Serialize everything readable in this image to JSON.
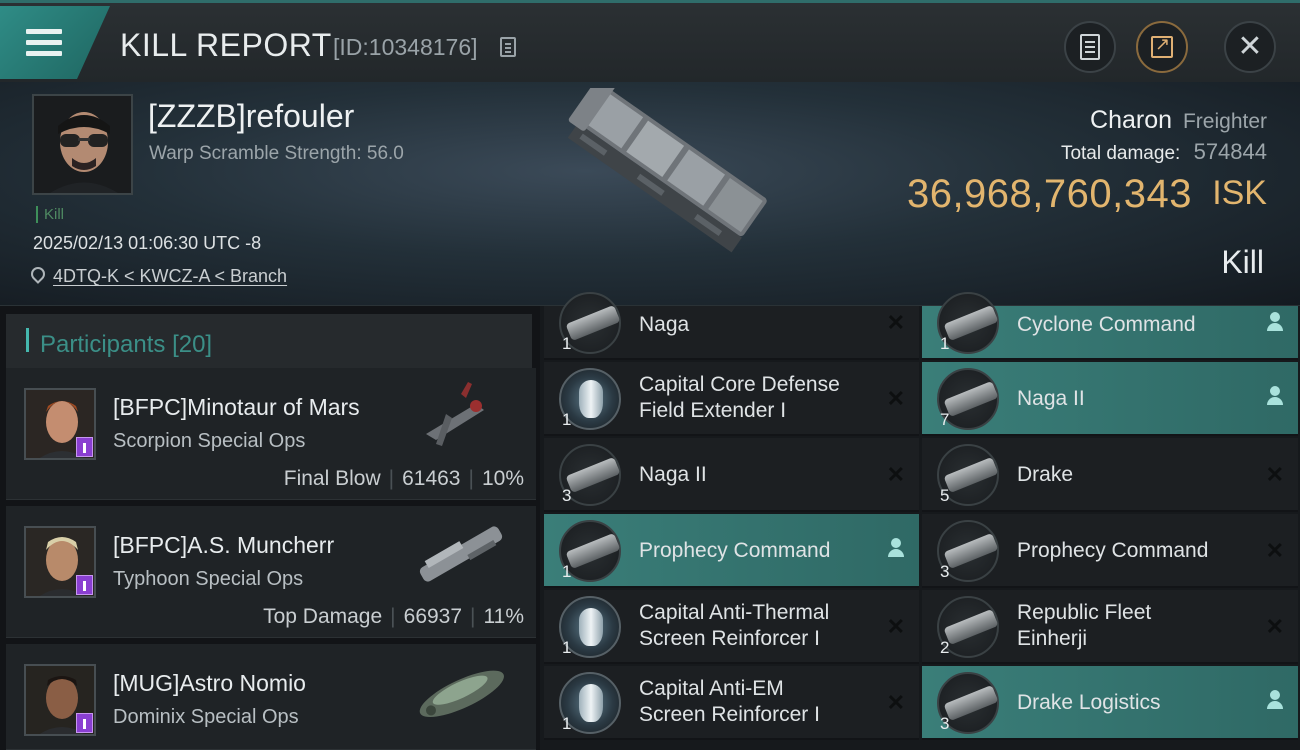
{
  "header": {
    "title": "KILL REPORT",
    "report_id": "[ID:10348176]"
  },
  "victim": {
    "name": "[ZZZB]refouler",
    "scramble": "Warp Scramble Strength: 56.0",
    "kill_tag": "Kill",
    "time": "2025/02/13 01:06:30 UTC -8",
    "location": "4DTQ-K < KWCZ-A < Branch",
    "ship_name": "Charon",
    "ship_class": "Freighter",
    "total_damage_label": "Total damage:",
    "total_damage": "574844",
    "isk_value": "36,968,760,343",
    "isk_unit": "ISK",
    "result": "Kill"
  },
  "participants": {
    "label": "Participants",
    "count": "[20]",
    "rows": [
      {
        "name": "[BFPC]Minotaur of Mars",
        "ship": "Scorpion Special Ops",
        "stat_label": "Final Blow",
        "damage": "61463",
        "percent": "10%"
      },
      {
        "name": "[BFPC]A.S. Muncherr",
        "ship": "Typhoon Special Ops",
        "stat_label": "Top Damage",
        "damage": "66937",
        "percent": "11%"
      },
      {
        "name": "[MUG]Astro Nomio",
        "ship": "Dominix Special Ops"
      }
    ]
  },
  "grid": {
    "left": [
      {
        "qty": "1",
        "label1": "Naga",
        "label2": "",
        "type": "ship",
        "icon": "ship-icon",
        "action": "close-icon"
      },
      {
        "qty": "1",
        "label1": "Capital Core Defense",
        "label2": "Field Extender I",
        "type": "module",
        "icon": "module-icon",
        "action": "close-icon"
      },
      {
        "qty": "3",
        "label1": "Naga II",
        "label2": "",
        "type": "ship",
        "icon": "ship-icon",
        "action": "close-icon"
      },
      {
        "qty": "1",
        "label1": "Prophecy Command",
        "label2": "",
        "type": "ship",
        "icon": "ship-icon",
        "action": "person-icon",
        "highlight": true
      },
      {
        "qty": "1",
        "label1": "Capital Anti-Thermal",
        "label2": "Screen Reinforcer I",
        "type": "module",
        "icon": "module-icon",
        "action": "close-icon"
      },
      {
        "qty": "1",
        "label1": "Capital Anti-EM",
        "label2": "Screen Reinforcer I",
        "type": "module",
        "icon": "module-icon",
        "action": "close-icon"
      }
    ],
    "right": [
      {
        "qty": "1",
        "label1": "Cyclone Command",
        "label2": "",
        "type": "ship",
        "icon": "ship-icon",
        "action": "person-icon",
        "highlight": true
      },
      {
        "qty": "7",
        "label1": "Naga II",
        "label2": "",
        "type": "ship",
        "icon": "ship-icon",
        "action": "person-icon",
        "highlight": true
      },
      {
        "qty": "5",
        "label1": "Drake",
        "label2": "",
        "type": "ship",
        "icon": "ship-icon",
        "action": "close-icon"
      },
      {
        "qty": "3",
        "label1": "Prophecy Command",
        "label2": "",
        "type": "ship",
        "icon": "ship-icon",
        "action": "close-icon"
      },
      {
        "qty": "2",
        "label1": "Republic Fleet",
        "label2": "Einherji",
        "type": "ship",
        "icon": "ship-icon",
        "action": "close-icon"
      },
      {
        "qty": "3",
        "label1": "Drake Logistics",
        "label2": "",
        "type": "ship",
        "icon": "ship-icon",
        "action": "person-icon",
        "highlight": true
      }
    ]
  },
  "colors": {
    "accent": "#45b8ae",
    "isk": "#e2b56e",
    "highlight": "#3a7e79"
  }
}
